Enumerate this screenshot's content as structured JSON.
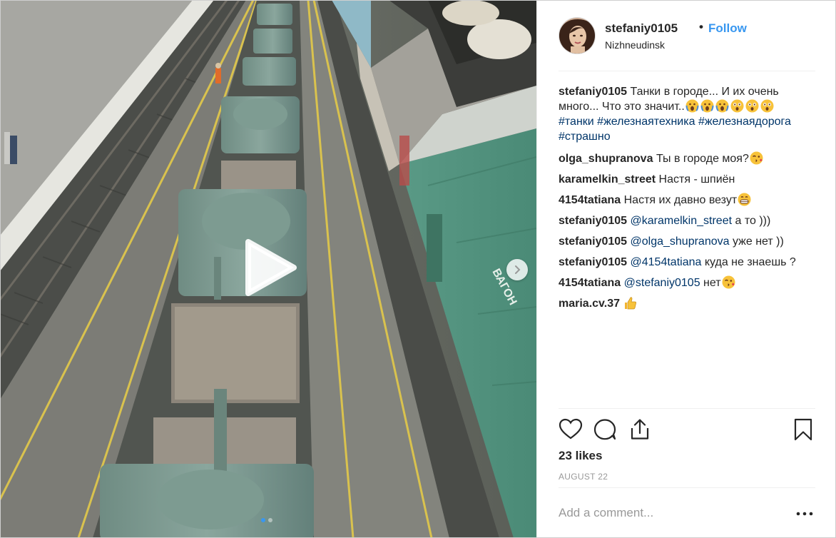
{
  "post": {
    "username": "stefaniy0105",
    "bullet": "•",
    "follow_label": "Follow",
    "location": "Nizhneudinsk"
  },
  "caption": {
    "user": "stefaniy0105",
    "text": "Танки в городе... И их очень много... Что это значит..",
    "emojis": [
      "scream-emoji",
      "scream-emoji",
      "scream-emoji",
      "astonished-emoji",
      "astonished-emoji",
      "astonished-emoji"
    ],
    "hashtags": [
      "#танки",
      "#железнаятехника",
      "#железнаядорога",
      "#страшно"
    ]
  },
  "comments": [
    {
      "user": "olga_shupranova",
      "text": "Ты в городе моя?",
      "emoji": "kiss-wink-emoji"
    },
    {
      "user": "karamelkin_street",
      "text": "Настя - шпиён"
    },
    {
      "user": "4154tatiana",
      "text": "Настя их давно везут",
      "emoji": "grin-emoji"
    },
    {
      "user": "stefaniy0105",
      "mention": "@karamelkin_street",
      "text": " а то )))"
    },
    {
      "user": "stefaniy0105",
      "mention": "@olga_shupranova",
      "text": " уже нет ))"
    },
    {
      "user": "stefaniy0105",
      "mention": "@4154tatiana",
      "text": " куда не знаешь ?"
    },
    {
      "user": "4154tatiana",
      "mention": "@stefaniy0105",
      "text": " нет",
      "emoji": "kiss-wink-emoji"
    },
    {
      "user": "maria.cv.37",
      "text": "",
      "emoji": "thumbs-up-emoji"
    }
  ],
  "actions": {
    "icons": [
      "heart-icon",
      "comment-icon",
      "share-icon",
      "bookmark-icon"
    ],
    "likes": "23 likes",
    "date": "AUGUST 22"
  },
  "add_comment": {
    "placeholder": "Add a comment...",
    "more_icon": "more-options-icon"
  },
  "media": {
    "play_icon": "play-icon",
    "next_icon": "chevron-right-icon",
    "carousel_count": 2,
    "carousel_active": 0
  },
  "colors": {
    "link": "#3897f0",
    "hashtag": "#003569",
    "muted": "#999999",
    "border": "#efefef"
  }
}
